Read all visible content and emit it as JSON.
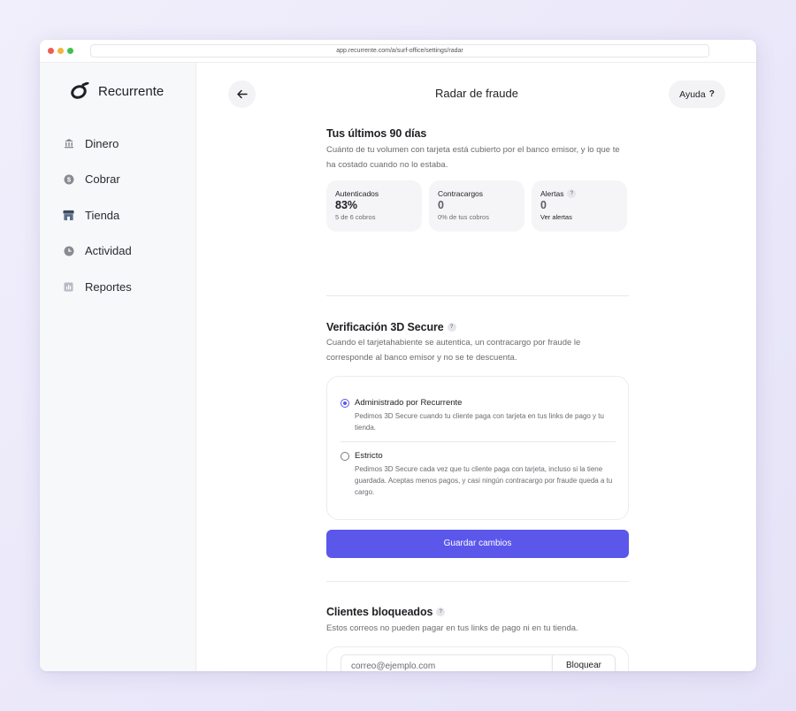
{
  "browser": {
    "url": "app.recurrente.com/a/surf-office/settings/radar"
  },
  "brand": {
    "name": "Recurrente",
    "logo_icon": "recurrente-logo-icon"
  },
  "sidebar": {
    "items": [
      {
        "label": "Dinero",
        "icon": "bank-icon"
      },
      {
        "label": "Cobrar",
        "icon": "dollar-icon"
      },
      {
        "label": "Tienda",
        "icon": "store-icon"
      },
      {
        "label": "Actividad",
        "icon": "clock-icon"
      },
      {
        "label": "Reportes",
        "icon": "report-icon"
      }
    ]
  },
  "header": {
    "title": "Radar de fraude",
    "help_label": "Ayuda",
    "help_icon": "?"
  },
  "summary": {
    "title": "Tus últimos 90 días",
    "description": "Cuánto de tu volumen con tarjeta está cubierto por el banco emisor, y lo que te ha costado cuando no lo estaba.",
    "stats": [
      {
        "label": "Autenticados",
        "value": "83%",
        "sub": "5 de 6 cobros"
      },
      {
        "label": "Contracargos",
        "value": "0",
        "sub": "0% de tus cobros"
      },
      {
        "label": "Alertas",
        "value": "0",
        "sub": "Ver alertas"
      }
    ]
  },
  "secure3d": {
    "title": "Verificación 3D Secure",
    "description": "Cuando el tarjetahabiente se autentica, un contracargo por fraude le corresponde al banco emisor y no se te descuenta.",
    "options": [
      {
        "label": "Administrado por Recurrente",
        "description": "Pedimos 3D Secure cuando tu cliente paga con tarjeta en tus links de pago y tu tienda.",
        "selected": true
      },
      {
        "label": "Estricto",
        "description": "Pedimos 3D Secure cada vez que tu cliente paga con tarjeta, incluso si la tiene guardada. Aceptas menos pagos, y casi ningún contracargo por fraude queda a tu cargo.",
        "selected": false
      }
    ],
    "save_label": "Guardar cambios"
  },
  "blocked": {
    "title": "Clientes bloqueados",
    "description": "Estos correos no pueden pagar en tus links de pago ni en tu tienda.",
    "input_placeholder": "correo@ejemplo.com",
    "button_label": "Bloquear"
  },
  "colors": {
    "accent": "#5b57ea",
    "background": "#efedfb"
  }
}
